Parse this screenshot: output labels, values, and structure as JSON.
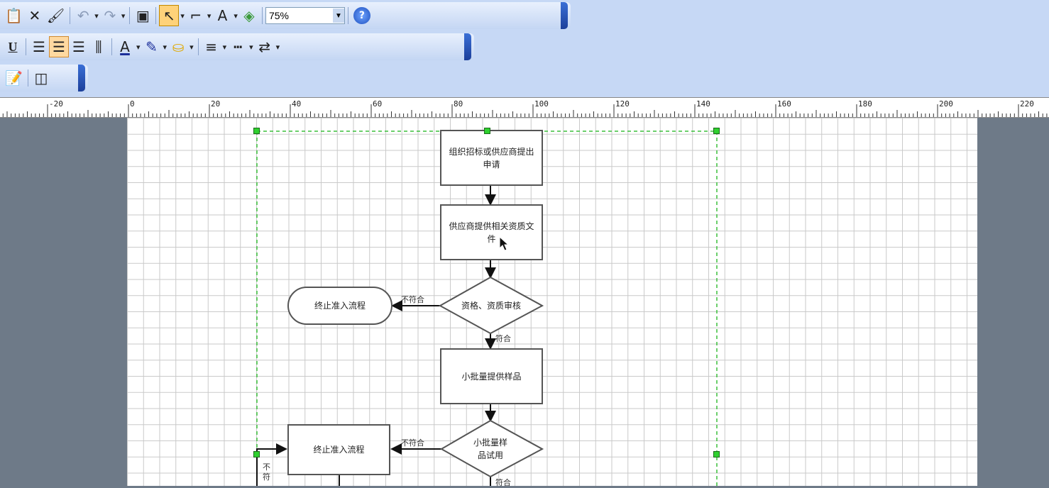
{
  "toolbar_standard": {
    "zoom_value": "75%",
    "buttons": [
      "paste-icon",
      "cut-icon",
      "format-painter-icon",
      "undo-icon",
      "redo-icon",
      "shapes-icon",
      "pointer-tool-icon",
      "connector-tool-icon",
      "text-tool-icon",
      "fill-color-tool-icon",
      "help-icon"
    ]
  },
  "toolbar_format": {
    "underline_label": "U",
    "text_color_letter": "A"
  },
  "ruler": {
    "labels": [
      "-20",
      "0",
      "20",
      "40",
      "60",
      "80",
      "100",
      "120",
      "140",
      "160",
      "180",
      "200",
      "220"
    ]
  },
  "diagram": {
    "nodes": {
      "apply": "组织招标或供应商提出申请",
      "provide_docs": "供应商提供相关资质文件",
      "review": "资格、资质审核",
      "terminate_1": "终止准入流程",
      "sample": "小批量提供样品",
      "trial": "小批量样品试用",
      "terminate_2": "终止准入流程"
    },
    "labels": {
      "reject_1": "不符合",
      "pass_1": "符合",
      "reject_2": "不符合",
      "pass_2": "符合",
      "reject_3": "不符"
    }
  },
  "colors": {
    "toolbar_bg": "#c6d8f5",
    "workspace_bg": "#6e7a88",
    "selection_handle": "#2fd02f",
    "active_button": "#ffd27a"
  }
}
